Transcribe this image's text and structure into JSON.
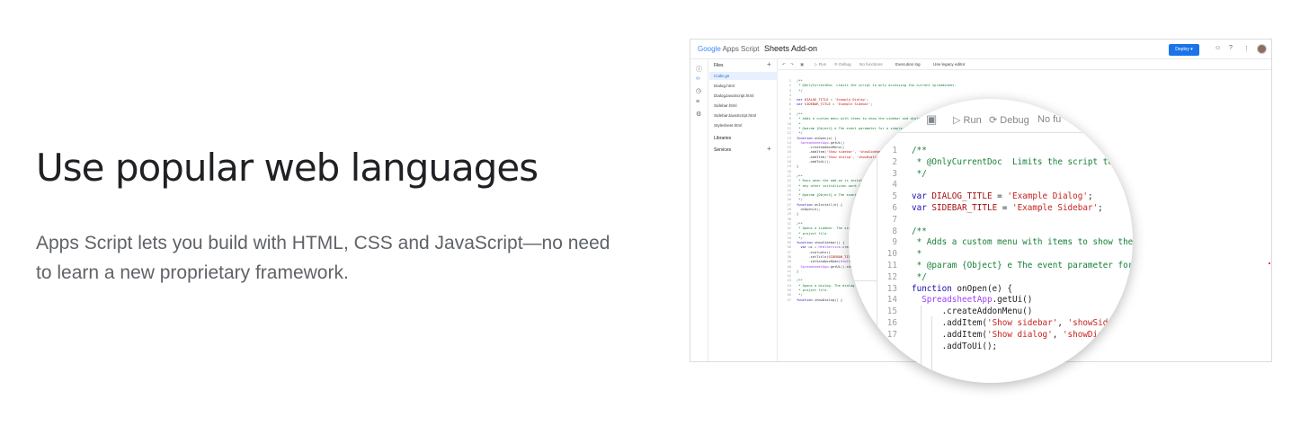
{
  "hero": {
    "headline": "Use popular web languages",
    "body": "Apps Script lets you build with HTML, CSS and JavaScript—no need to learn a new proprietary framework."
  },
  "editor": {
    "logo_google": "Google",
    "logo_product": "Apps Script",
    "project_title": "Sheets Add-on",
    "deploy_label": "Deploy ▾",
    "files_header": "Files",
    "files": [
      "Code.gs",
      "Dialog.html",
      "DialogJavaScript.html",
      "Sidebar.html",
      "SidebarJavaScript.html",
      "Stylesheet.html"
    ],
    "libraries_label": "Libraries",
    "services_label": "Services",
    "toolbar": {
      "run": "▷ Run",
      "debug": "⟳ Debug",
      "functions": "No functions",
      "execution_log": "Execution log",
      "legacy": "Use legacy editor"
    },
    "icons": [
      "info-icon",
      "code-icon",
      "clock-icon",
      "executions-icon",
      "gear-icon",
      "add-person-icon",
      "help-icon",
      "apps-grid-icon"
    ]
  },
  "magnifier": {
    "run": "▷ Run",
    "debug": "⟳ Debug",
    "functions": "No fu"
  },
  "colors": {
    "deploy": "#1a73e8",
    "comment": "#188038",
    "string": "#c5221f",
    "identifier": "#a142f4"
  }
}
